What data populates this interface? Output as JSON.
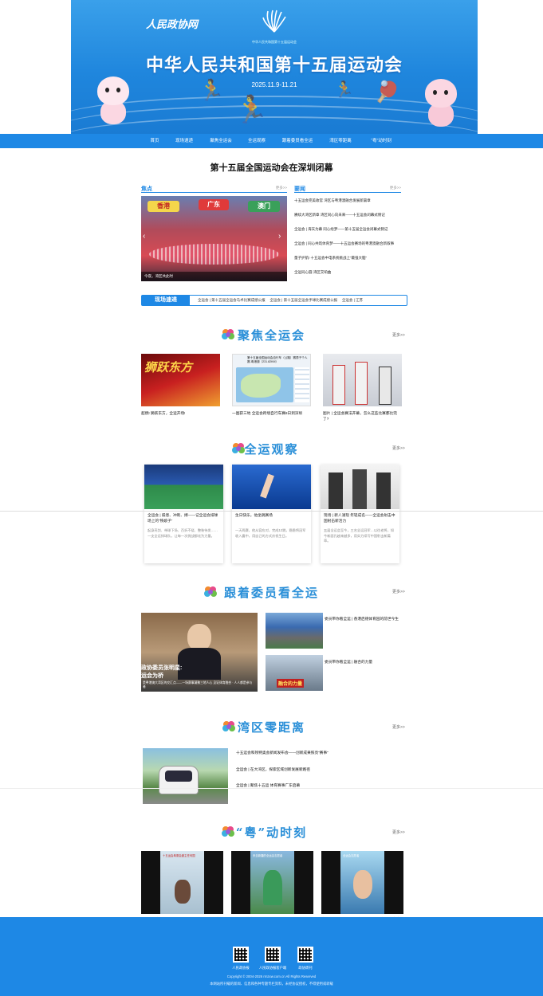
{
  "banner": {
    "brand": "人民政协网",
    "emblem_caption": "中华人民共和国第十五届运动会",
    "title": "中华人民共和国第十五届运动会",
    "date": "2025.11.9-11.21"
  },
  "nav": [
    "首页",
    "现场速递",
    "聚焦全运会",
    "全运观察",
    "跟着委员看全运",
    "湾区零距离",
    "“粤”动时刻"
  ],
  "headline": "第十五届全国运动会在深圳闭幕",
  "focus": {
    "label": "焦点",
    "more": "更多>>",
    "photo_caption": "今夜，湾区共此时",
    "signs": [
      "香港",
      "广东",
      "澳门"
    ]
  },
  "news": {
    "label": "要闻",
    "more": "更多>>",
    "items": [
      "十五运会完美收官 湾区与粤港澳融合发展新篇章",
      "赓续大湾区新章 湾区同心向未来——十五运会闭幕式侧记",
      "全运会 | 海天为幕 同心绘梦——第十五届全运会闭幕式侧记",
      "全运会 | 同心共筑体育梦——十五运会赛场的粤港澳融合新叙事",
      "量子护航! 十五运会中电系统挑战上“最强大脑”",
      "全运同心圆 湾区交响曲"
    ]
  },
  "scene": {
    "tag": "现场速递",
    "text": "全运会 | 第十五届全运会马术比赛成绩公报 　全运会 | 第十五届全运会手球比赛成绩公报 　全运会 | 江苏"
  },
  "focus_games": {
    "title": "聚焦全运会",
    "more": "更多>>",
    "cards": [
      "超燃! 狮跃东方，全运开场!",
      "一图获三地 全运会跨境自行车赛8日到深圳",
      "图片 | 全运会赛法开幕，怎么这些比赛都比完了?"
    ],
    "lion_text": "狮跃东方",
    "doc_title": "第十五届全国运动会自行车（公路）赛男子个人赛-粤港澳（231.82KM）"
  },
  "observe": {
    "title": "全运观察",
    "more": "更多>>",
    "cards": [
      {
        "title": "全运会 | 躁患、冲刺、搏——记全运会排球场上的“铁娘子”",
        "desc": "起身亮剑、带球下场、百折不挠、整装待发……一支全运排球队，让每一次挑战都化为力量。"
      },
      {
        "title": "生日快乐，他坐跳赛场",
        "desc": "一天两赛，他从容应对，完成12跳，稳稳将冠军收入囊中，用自己的方式庆祝生日。"
      },
      {
        "title": "现场 | 新人涌现 年轻成名——全运会射击中国射击新活力",
        "desc": "五届全运会至今，三名全运冠军…以往老将，如今新面孔越来越多，用实力续写中国射击新篇章。"
      }
    ]
  },
  "member": {
    "title": "跟着委员看全运",
    "more": "更多>>",
    "main_overlay": "政协委员张明星:",
    "main_overlay2": "运会为桥",
    "main_caption": "是粤港澳大湾区的交汇点——一场赛事凝聚三地人心 见证体育融合 · 人人都是参与者",
    "items": [
      "委员带你看全运 | 香港启德体育园的前世今生",
      "委员带你看全运 | 融合的力量"
    ],
    "thumb2_text": "融合的力量"
  },
  "bay": {
    "title": "湾区零距离",
    "more": "更多>>",
    "items": [
      "十五运会和残特奥会新闻发布会——创新成果照亮“赛事”",
      "全运会 | 在大湾区，探索区域创新发展新路径",
      "全运会 | 聚焦十五运 体育赛事广东启幕"
    ]
  },
  "yue": {
    "title": "“粤”动时刻",
    "more": "更多>>",
    "cards": [
      "十五运会粤委会副主任何国：运再今月澳门首事造连 为大家打造多元化文体体验",
      "来自新疆的全运会志愿者拉力查亚尔·艾尼瓦尔：“今天，我终于圆梦了!”",
      "全运会志愿者许可乐：祝运动员们取得优异成绩!"
    ],
    "poster_text": [
      "十五运会粤委会副主任何国",
      "来自新疆的全运会志愿者",
      "全运会志愿者"
    ]
  },
  "footer": {
    "qr_labels": [
      "人民政协报",
      "人民政协报客户端",
      "政协周刊"
    ],
    "copyright": "Copyright © 2004-2026 rmzxw.com.cn All Rights Reserved",
    "notice": "本网站所刊载的新闻、信息和各种专题专栏资料，未经协议授权，不得使用或转载"
  },
  "colors": {
    "primary": "#1e88e5",
    "section_title": "#2a8fd8"
  }
}
